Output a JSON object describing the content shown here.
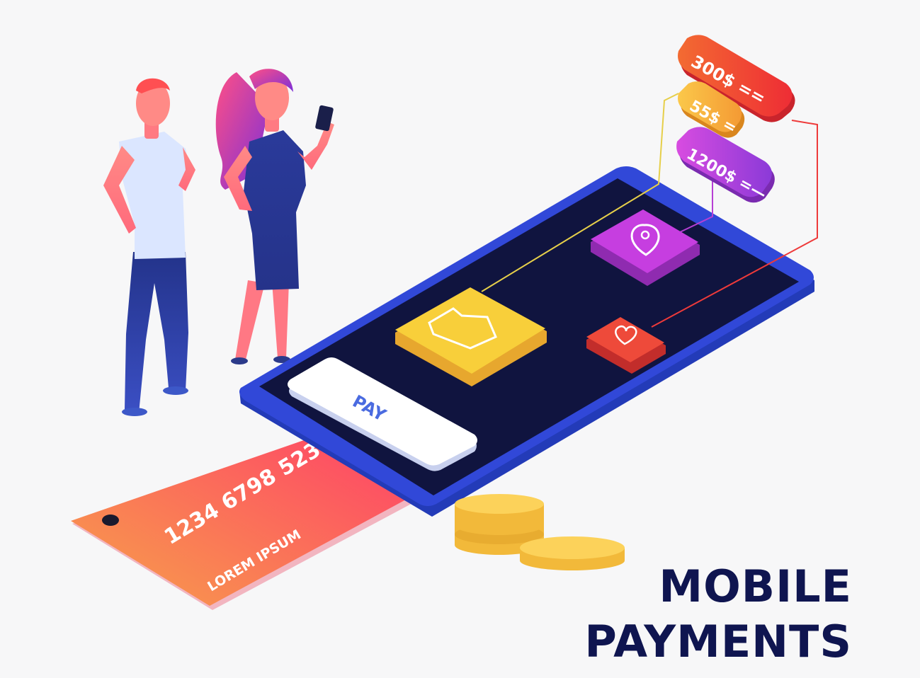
{
  "illustration": {
    "title_line1": "MOBILE",
    "title_line2": "PAYMENTS",
    "pay_button_label": "PAY",
    "card": {
      "number": "1234 6798 5231",
      "holder": "LOREM IPSUM"
    },
    "price_tags": [
      {
        "label": "300$ ==",
        "color": "#f04a2c"
      },
      {
        "label": "55$ =",
        "color": "#f7b43c"
      },
      {
        "label": "1200$ =—",
        "color": "#b63fd4"
      }
    ],
    "app_tiles": [
      {
        "icon": "thumbs-up-icon",
        "color": "#f8cf3a"
      },
      {
        "icon": "location-pin-icon",
        "color": "#c63ee0"
      },
      {
        "icon": "heart-icon",
        "color": "#ee4a3a"
      }
    ],
    "colors": {
      "phone_body": "#3148d8",
      "phone_screen": "#10143f",
      "title_text": "#0f1550",
      "card_gradient_start": "#f7a14a",
      "card_gradient_end": "#ff3a6a",
      "coin": "#f9c94a"
    }
  }
}
